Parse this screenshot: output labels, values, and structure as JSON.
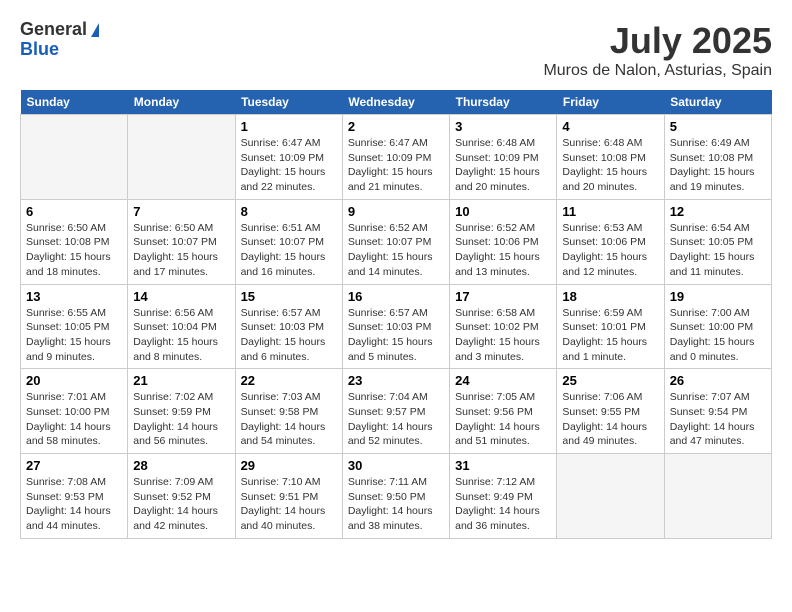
{
  "header": {
    "logo_general": "General",
    "logo_blue": "Blue",
    "month_title": "July 2025",
    "location": "Muros de Nalon, Asturias, Spain"
  },
  "weekdays": [
    "Sunday",
    "Monday",
    "Tuesday",
    "Wednesday",
    "Thursday",
    "Friday",
    "Saturday"
  ],
  "weeks": [
    [
      {
        "num": "",
        "info": ""
      },
      {
        "num": "",
        "info": ""
      },
      {
        "num": "1",
        "info": "Sunrise: 6:47 AM\nSunset: 10:09 PM\nDaylight: 15 hours\nand 22 minutes."
      },
      {
        "num": "2",
        "info": "Sunrise: 6:47 AM\nSunset: 10:09 PM\nDaylight: 15 hours\nand 21 minutes."
      },
      {
        "num": "3",
        "info": "Sunrise: 6:48 AM\nSunset: 10:09 PM\nDaylight: 15 hours\nand 20 minutes."
      },
      {
        "num": "4",
        "info": "Sunrise: 6:48 AM\nSunset: 10:08 PM\nDaylight: 15 hours\nand 20 minutes."
      },
      {
        "num": "5",
        "info": "Sunrise: 6:49 AM\nSunset: 10:08 PM\nDaylight: 15 hours\nand 19 minutes."
      }
    ],
    [
      {
        "num": "6",
        "info": "Sunrise: 6:50 AM\nSunset: 10:08 PM\nDaylight: 15 hours\nand 18 minutes."
      },
      {
        "num": "7",
        "info": "Sunrise: 6:50 AM\nSunset: 10:07 PM\nDaylight: 15 hours\nand 17 minutes."
      },
      {
        "num": "8",
        "info": "Sunrise: 6:51 AM\nSunset: 10:07 PM\nDaylight: 15 hours\nand 16 minutes."
      },
      {
        "num": "9",
        "info": "Sunrise: 6:52 AM\nSunset: 10:07 PM\nDaylight: 15 hours\nand 14 minutes."
      },
      {
        "num": "10",
        "info": "Sunrise: 6:52 AM\nSunset: 10:06 PM\nDaylight: 15 hours\nand 13 minutes."
      },
      {
        "num": "11",
        "info": "Sunrise: 6:53 AM\nSunset: 10:06 PM\nDaylight: 15 hours\nand 12 minutes."
      },
      {
        "num": "12",
        "info": "Sunrise: 6:54 AM\nSunset: 10:05 PM\nDaylight: 15 hours\nand 11 minutes."
      }
    ],
    [
      {
        "num": "13",
        "info": "Sunrise: 6:55 AM\nSunset: 10:05 PM\nDaylight: 15 hours\nand 9 minutes."
      },
      {
        "num": "14",
        "info": "Sunrise: 6:56 AM\nSunset: 10:04 PM\nDaylight: 15 hours\nand 8 minutes."
      },
      {
        "num": "15",
        "info": "Sunrise: 6:57 AM\nSunset: 10:03 PM\nDaylight: 15 hours\nand 6 minutes."
      },
      {
        "num": "16",
        "info": "Sunrise: 6:57 AM\nSunset: 10:03 PM\nDaylight: 15 hours\nand 5 minutes."
      },
      {
        "num": "17",
        "info": "Sunrise: 6:58 AM\nSunset: 10:02 PM\nDaylight: 15 hours\nand 3 minutes."
      },
      {
        "num": "18",
        "info": "Sunrise: 6:59 AM\nSunset: 10:01 PM\nDaylight: 15 hours\nand 1 minute."
      },
      {
        "num": "19",
        "info": "Sunrise: 7:00 AM\nSunset: 10:00 PM\nDaylight: 15 hours\nand 0 minutes."
      }
    ],
    [
      {
        "num": "20",
        "info": "Sunrise: 7:01 AM\nSunset: 10:00 PM\nDaylight: 14 hours\nand 58 minutes."
      },
      {
        "num": "21",
        "info": "Sunrise: 7:02 AM\nSunset: 9:59 PM\nDaylight: 14 hours\nand 56 minutes."
      },
      {
        "num": "22",
        "info": "Sunrise: 7:03 AM\nSunset: 9:58 PM\nDaylight: 14 hours\nand 54 minutes."
      },
      {
        "num": "23",
        "info": "Sunrise: 7:04 AM\nSunset: 9:57 PM\nDaylight: 14 hours\nand 52 minutes."
      },
      {
        "num": "24",
        "info": "Sunrise: 7:05 AM\nSunset: 9:56 PM\nDaylight: 14 hours\nand 51 minutes."
      },
      {
        "num": "25",
        "info": "Sunrise: 7:06 AM\nSunset: 9:55 PM\nDaylight: 14 hours\nand 49 minutes."
      },
      {
        "num": "26",
        "info": "Sunrise: 7:07 AM\nSunset: 9:54 PM\nDaylight: 14 hours\nand 47 minutes."
      }
    ],
    [
      {
        "num": "27",
        "info": "Sunrise: 7:08 AM\nSunset: 9:53 PM\nDaylight: 14 hours\nand 44 minutes."
      },
      {
        "num": "28",
        "info": "Sunrise: 7:09 AM\nSunset: 9:52 PM\nDaylight: 14 hours\nand 42 minutes."
      },
      {
        "num": "29",
        "info": "Sunrise: 7:10 AM\nSunset: 9:51 PM\nDaylight: 14 hours\nand 40 minutes."
      },
      {
        "num": "30",
        "info": "Sunrise: 7:11 AM\nSunset: 9:50 PM\nDaylight: 14 hours\nand 38 minutes."
      },
      {
        "num": "31",
        "info": "Sunrise: 7:12 AM\nSunset: 9:49 PM\nDaylight: 14 hours\nand 36 minutes."
      },
      {
        "num": "",
        "info": ""
      },
      {
        "num": "",
        "info": ""
      }
    ]
  ]
}
